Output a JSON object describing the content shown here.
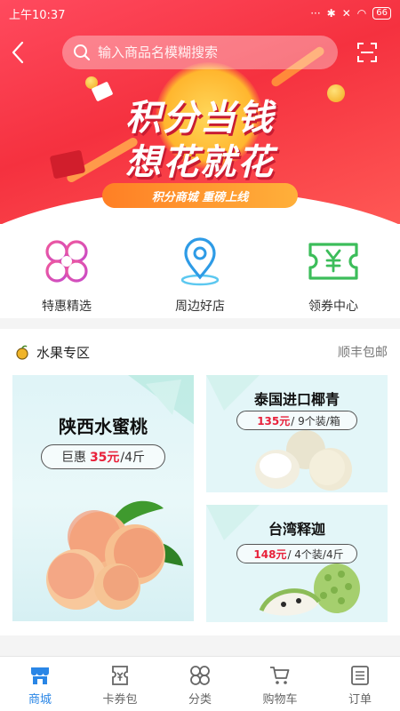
{
  "status_bar": {
    "time": "上午10:37",
    "battery": "66"
  },
  "search": {
    "placeholder": "输入商品名模糊搜索"
  },
  "banner": {
    "title_line1": "积分当钱",
    "title_line2": "想花就花",
    "subtitle": "积分商城  重磅上线",
    "slide_count": 5,
    "active_slide": 1
  },
  "quick_nav": [
    {
      "label": "特惠精选",
      "icon": "clover-icon",
      "color": "#e0468a"
    },
    {
      "label": "周边好店",
      "icon": "location-pin-icon",
      "color": "#2e9be6"
    },
    {
      "label": "领券中心",
      "icon": "coupon-yen-icon",
      "color": "#3cbd5a"
    }
  ],
  "fruit_section": {
    "title": "水果专区",
    "more": "顺丰包邮",
    "cards": [
      {
        "name": "陕西水蜜桃",
        "price_prefix": "巨惠",
        "price": "35元",
        "unit": "/4斤"
      },
      {
        "name": "泰国进口椰青",
        "price_prefix": "",
        "price": "135元",
        "unit": " / 9个装/箱"
      },
      {
        "name": "台湾释迦",
        "price_prefix": "",
        "price": "148元",
        "unit": " / 4个装/4斤"
      }
    ]
  },
  "bottom_nav": [
    {
      "label": "商城",
      "icon": "store-icon",
      "active": true
    },
    {
      "label": "卡券包",
      "icon": "card-wallet-icon",
      "active": false
    },
    {
      "label": "分类",
      "icon": "category-icon",
      "active": false
    },
    {
      "label": "购物车",
      "icon": "cart-icon",
      "active": false
    },
    {
      "label": "订单",
      "icon": "order-list-icon",
      "active": false
    }
  ],
  "colors": {
    "banner_red": "#f5313f",
    "accent_blue": "#2a86e6",
    "price_red": "#e8213a"
  }
}
